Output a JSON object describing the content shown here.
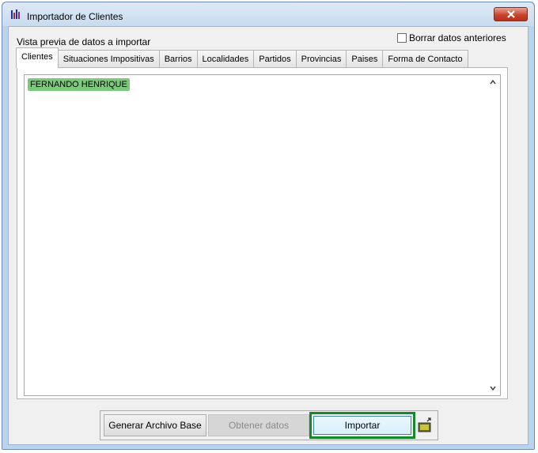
{
  "window": {
    "title": "Importador de Clientes",
    "icons": {
      "app": "bar-chart-icon",
      "close": "close-icon"
    }
  },
  "header": {
    "preview_label": "Vista previa de datos a importar",
    "clear_checkbox_label": "Borrar datos anteriores",
    "clear_checked": false
  },
  "tabs": [
    {
      "label": "Clientes",
      "active": true
    },
    {
      "label": "Situaciones Impositivas"
    },
    {
      "label": "Barrios"
    },
    {
      "label": "Localidades"
    },
    {
      "label": "Partidos"
    },
    {
      "label": "Provincias"
    },
    {
      "label": "Paises"
    },
    {
      "label": "Forma de Contacto"
    }
  ],
  "content": {
    "text": "FERNANDO HENRIQUE",
    "highlight_color": "#7cc97c"
  },
  "buttons": {
    "generate": "Generar Archivo Base",
    "obtain": "Obtener datos",
    "import": "Importar",
    "folder_icon": "open-folder-icon"
  },
  "colors": {
    "import_focus": "#138a2a",
    "close_button": "#c8452f"
  }
}
